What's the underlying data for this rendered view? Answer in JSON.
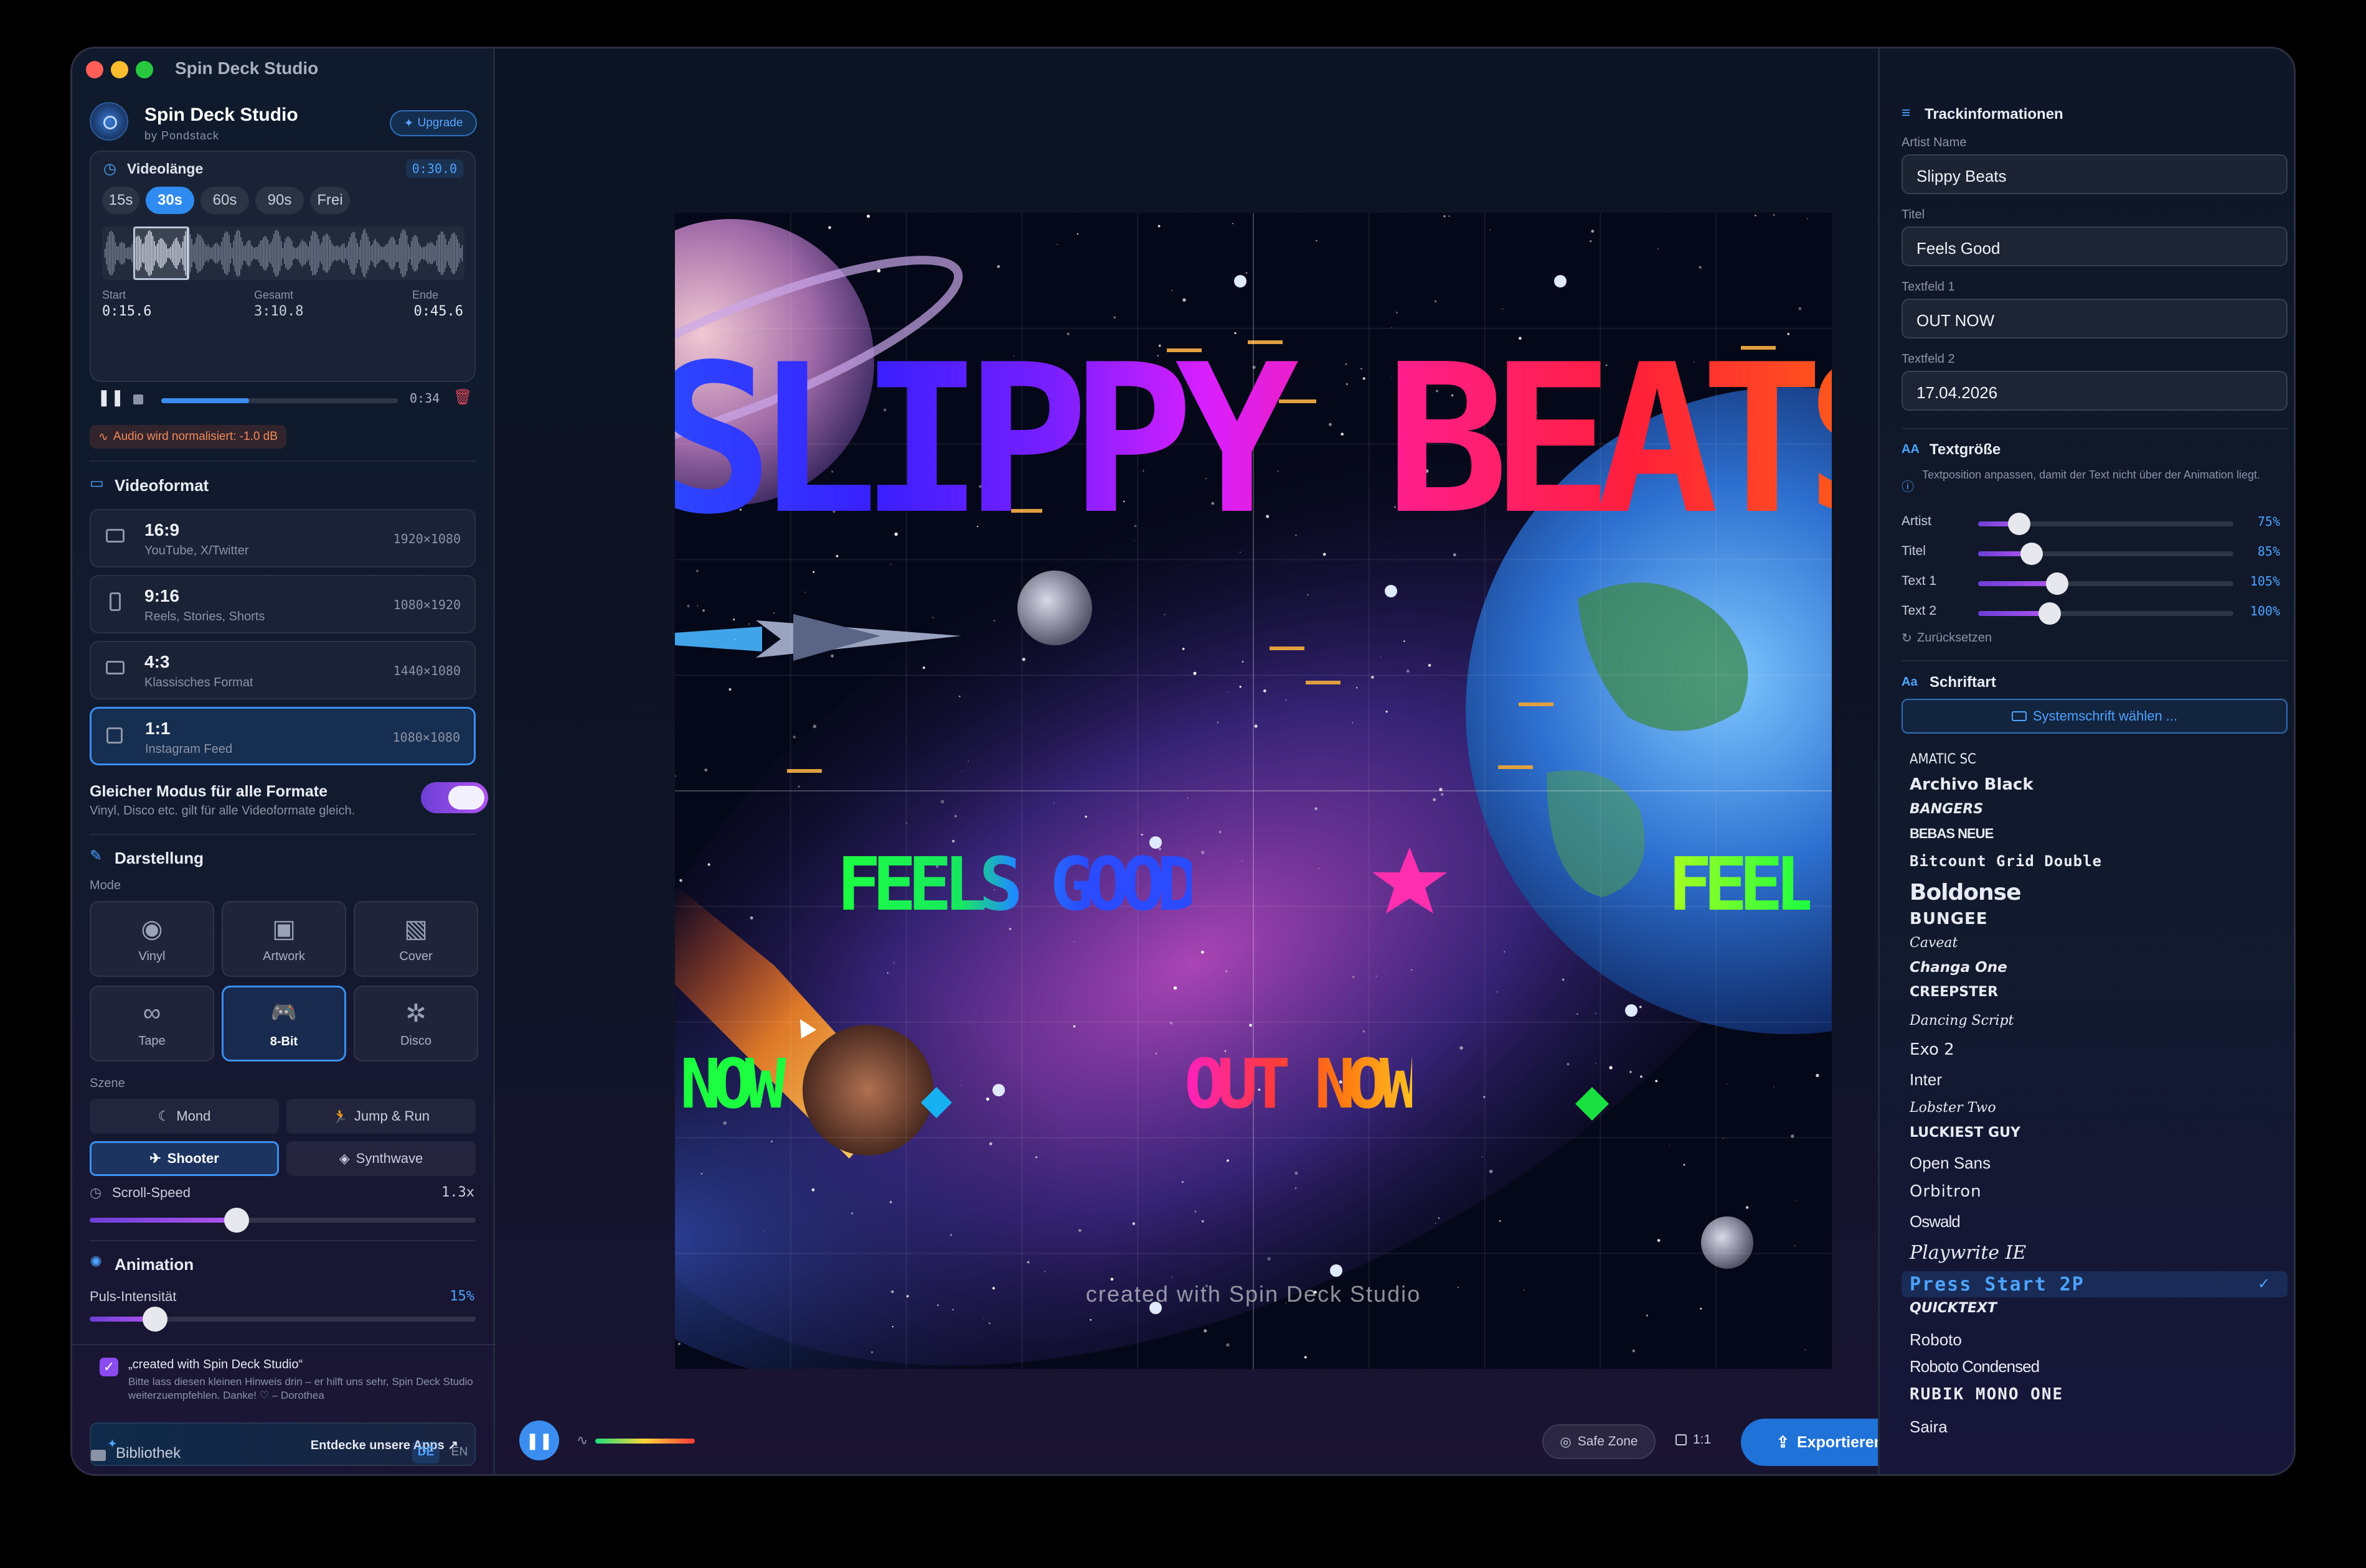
{
  "window": {
    "title": "Spin Deck Studio"
  },
  "sidebar": {
    "app_name": "Spin Deck Studio",
    "app_sub": "by Pondstack",
    "upgrade": "Upgrade",
    "video_length": {
      "label": "Videolänge",
      "value": "0:30.0",
      "options": [
        "15s",
        "30s",
        "60s",
        "90s",
        "Frei"
      ],
      "selected": "30s",
      "start_label": "Start",
      "start": "0:15.6",
      "total_label": "Gesamt",
      "total": "3:10.8",
      "end_label": "Ende",
      "end": "0:45.6",
      "time": "0:34",
      "progress": 0.37,
      "notice": "Audio wird normalisiert: -1.0 dB"
    },
    "videoformat": {
      "label": "Videoformat",
      "formats": [
        {
          "ratio": "16:9",
          "desc": "YouTube, X/Twitter",
          "res": "1920×1080"
        },
        {
          "ratio": "9:16",
          "desc": "Reels, Stories, Shorts",
          "res": "1080×1920"
        },
        {
          "ratio": "4:3",
          "desc": "Klassisches Format",
          "res": "1440×1080"
        },
        {
          "ratio": "1:1",
          "desc": "Instagram Feed",
          "res": "1080×1080"
        }
      ],
      "selected": "1:1"
    },
    "same_mode": {
      "title": "Gleicher Modus für alle Formate",
      "desc": "Vinyl, Disco etc. gilt für alle Videoformate gleich.",
      "on": true
    },
    "darstellung": {
      "label": "Darstellung",
      "mode_label": "Mode",
      "modes": [
        "Vinyl",
        "Artwork",
        "Cover",
        "Tape",
        "8-Bit",
        "Disco"
      ],
      "selected_mode": "8-Bit",
      "scene_label": "Szene",
      "scenes": [
        "Mond",
        "Jump & Run",
        "Shooter",
        "Synthwave"
      ],
      "selected_scene": "Shooter",
      "scroll_label": "Scroll-Speed",
      "scroll_value": "1.3x",
      "scroll_fraction": 0.38
    },
    "animation": {
      "label": "Animation",
      "pulse_label": "Puls-Intensität",
      "pulse_value": "15%",
      "pulse_fraction": 0.17
    },
    "credit": {
      "title": "„created with Spin Deck Studio“",
      "desc": "Bitte lass diesen kleinen Hinweis drin – er hilft uns sehr, Spin Deck Studio weiterzuempfehlen. Danke! ♡ – Dorothea",
      "checked": true
    },
    "discover": "Entdecke unsere Apps ↗",
    "library": "Bibliothek",
    "lang": [
      "DE",
      "EN"
    ],
    "lang_selected": "DE"
  },
  "canvas": {
    "artist_text": "SLIPPY BEATS",
    "title_text": "FEELS GOOD",
    "title_text_2": "FEEL",
    "text1_a": "NOW",
    "text1_b": "OUT NOW",
    "watermark": "created with Spin Deck Studio"
  },
  "bottombar": {
    "safe_zone": "Safe Zone",
    "ratio": "1:1",
    "export": "Exportieren"
  },
  "rightpanel": {
    "track_info": "Trackinformationen",
    "artist_label": "Artist Name",
    "artist": "Slippy Beats",
    "title_label": "Titel",
    "title": "Feels Good",
    "text1_label": "Textfeld 1",
    "text1": "OUT NOW",
    "text2_label": "Textfeld 2",
    "text2": "17.04.2026",
    "textsize": {
      "label": "Textgröße",
      "hint": "Textposition anpassen, damit der Text nicht über der Animation liegt.",
      "rows": [
        {
          "name": "Artist",
          "value": "75%",
          "fraction": 0.16
        },
        {
          "name": "Titel",
          "value": "85%",
          "fraction": 0.21
        },
        {
          "name": "Text 1",
          "value": "105%",
          "fraction": 0.31
        },
        {
          "name": "Text 2",
          "value": "100%",
          "fraction": 0.28
        }
      ],
      "reset": "Zurücksetzen"
    },
    "font": {
      "label": "Schriftart",
      "system": "Systemschrift wählen ...",
      "fonts": [
        "Amatic SC",
        "Archivo Black",
        "Bangers",
        "Bebas Neue",
        "Bitcount Grid Double",
        "Boldonse",
        "Bungee",
        "Caveat",
        "Changa One",
        "Creepster",
        "Dancing Script",
        "Exo 2",
        "Inter",
        "Lobster Two",
        "Luckiest Guy",
        "Open Sans",
        "Orbitron",
        "Oswald",
        "Playwrite IE",
        "Press Start 2P",
        "Quicktext",
        "Roboto",
        "Roboto Condensed",
        "Rubik Mono One",
        "Saira"
      ],
      "selected": "Press Start 2P"
    }
  }
}
